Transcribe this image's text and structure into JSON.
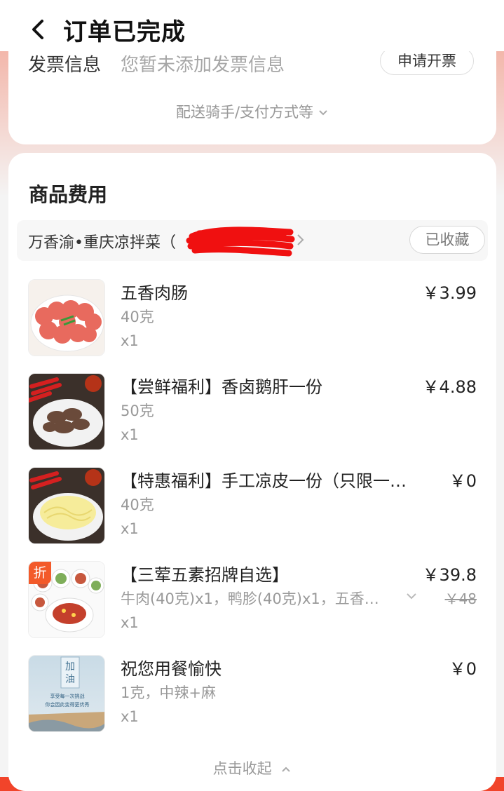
{
  "header": {
    "title": "订单已完成"
  },
  "invoice": {
    "label": "发票信息",
    "value": "您暂未添加发票信息",
    "button": "申请开票"
  },
  "more_info": "配送骑手/支付方式等",
  "goods_section": {
    "title": "商品费用",
    "store_name": "万香渝•重庆凉拌菜（",
    "favorite_button": "已收藏",
    "items": [
      {
        "name": "五香肉肠",
        "spec": "40克",
        "qty": "x1",
        "price": "￥3.99",
        "thumb_icon": "sausage-dish"
      },
      {
        "name": "【尝鲜福利】香卤鹅肝一份",
        "spec": "50克",
        "qty": "x1",
        "price": "￥4.88",
        "thumb_icon": "goose-liver-dish"
      },
      {
        "name": "【特惠福利】手工凉皮一份（只限一…",
        "spec": "40克",
        "qty": "x1",
        "price": "￥0",
        "thumb_icon": "cold-noodle-dish"
      },
      {
        "name": "【三荤五素招牌自选】",
        "spec": "牛肉(40克)x1，鸭胗(40克)x1，五香…",
        "qty": "x1",
        "price": "￥39.8",
        "original_price": "￥48",
        "badge": "折",
        "thumb_icon": "combo-dishes"
      },
      {
        "name": "祝您用餐愉快",
        "spec": "1克，中辣+麻",
        "qty": "x1",
        "price": "￥0",
        "thumb_icon": "greeting-card",
        "thumb_text": [
          "加",
          "油",
          "享受每一次挑战",
          "你会因此变得更优秀"
        ]
      }
    ],
    "collapse_label": "点击收起"
  },
  "colors": {
    "brand": "#f1442a",
    "badge": "#f35a2a",
    "muted": "#999999"
  }
}
